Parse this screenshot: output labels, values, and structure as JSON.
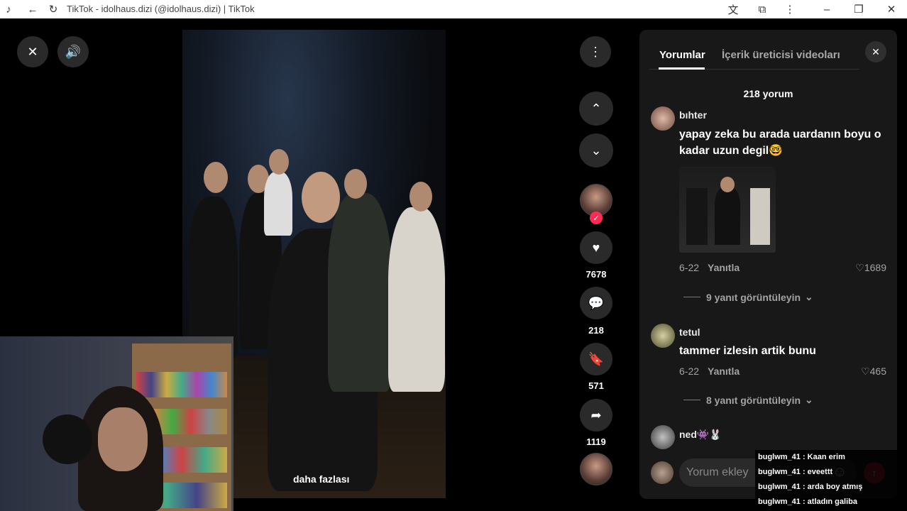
{
  "browser": {
    "title": "TikTok - idolhaus.dizi (@idolhaus.dizi) | TikTok"
  },
  "player": {
    "more_label": "daha fazlası",
    "likes": "7678",
    "comments": "218",
    "saves": "571",
    "shares": "1119"
  },
  "panel": {
    "tabs": [
      {
        "label": "Yorumlar"
      },
      {
        "label": "İçerik üreticisi videoları"
      }
    ],
    "comment_count": "218 yorum",
    "comments": [
      {
        "user": "bıhter",
        "text_line1": "yapay zeka bu arada uardanın boyu o",
        "text_line2": "kadar uzun degil🤓",
        "date": "6-22",
        "reply_label": "Yanıtla",
        "likes": "1689",
        "view_replies": "9 yanıt görüntüleyin"
      },
      {
        "user": "tetul",
        "text_line1": "tammer izlesin artik bunu",
        "date": "6-22",
        "reply_label": "Yanıtla",
        "likes": "465",
        "view_replies": "8 yanıt görüntüleyin"
      },
      {
        "user": "ned👾🐰"
      }
    ],
    "input_placeholder": "Yorum ekley"
  },
  "stream_chat": [
    "buglwm_41 : Kaan erim",
    "buglwm_41 : eveettt",
    "buglwm_41 : arda boy atmış",
    "buglwm_41 : atladın galiba"
  ],
  "colors": {
    "accent": "#fe2c55",
    "panel_bg": "#181818"
  }
}
